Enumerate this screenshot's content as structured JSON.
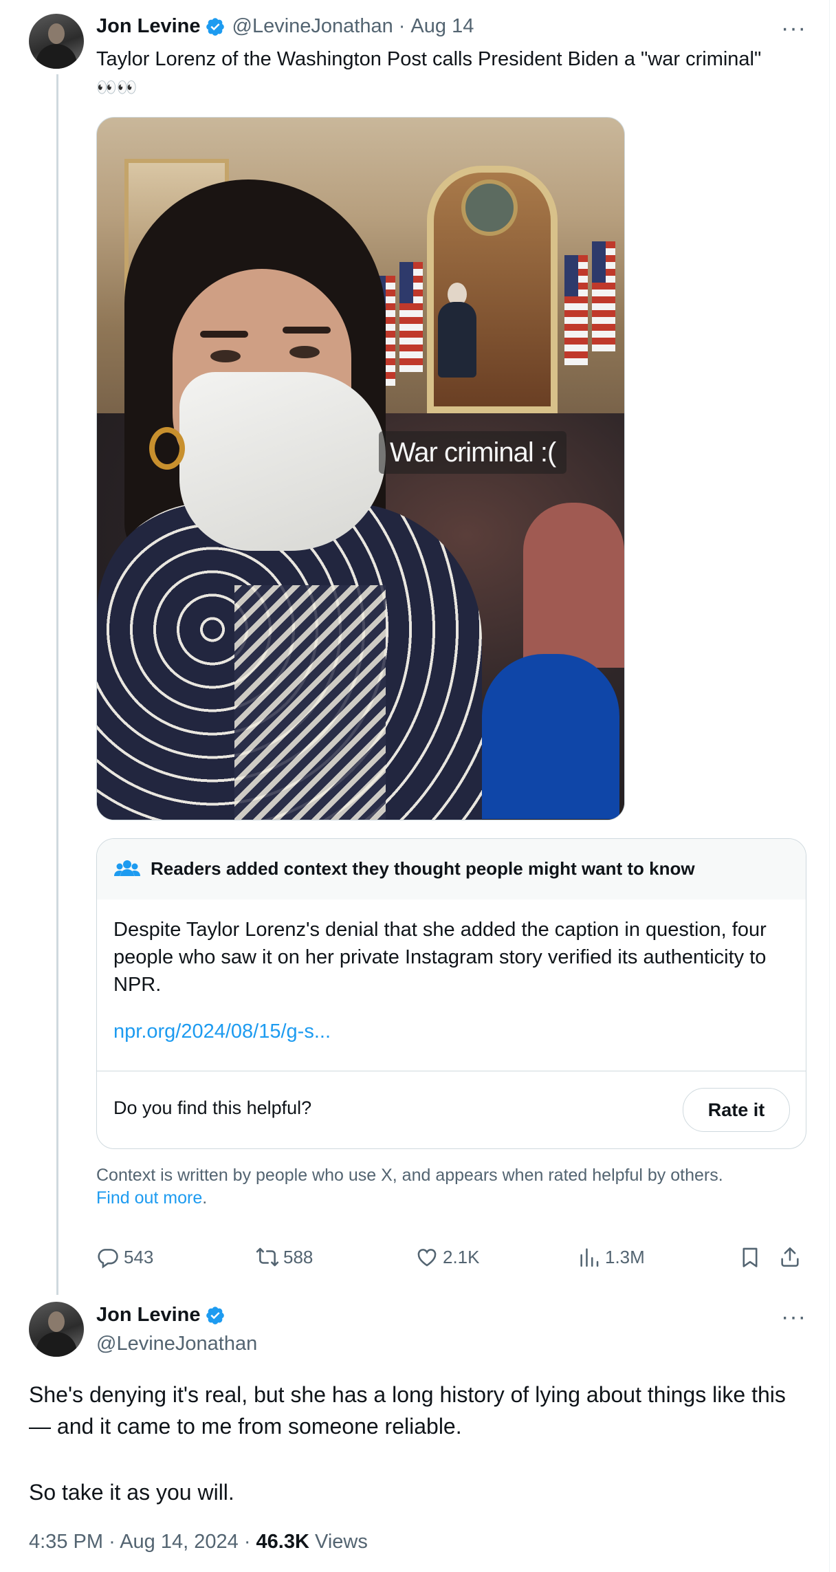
{
  "colors": {
    "accent": "#1d9bf0",
    "text": "#0f1419",
    "secondary": "#536471",
    "border": "#cfd9de",
    "verified": "#1d9bf0"
  },
  "tweet": {
    "author_name": "Jon Levine",
    "handle": "@LevineJonathan",
    "separator": "·",
    "date": "Aug 14",
    "text": "Taylor Lorenz of the Washington Post calls President Biden a \"war criminal\"",
    "emoji": "👀👀",
    "media": {
      "caption": "War criminal :("
    },
    "community_note": {
      "title": "Readers added context they thought people might want to know",
      "body": "Despite Taylor Lorenz's denial that she added the caption in question, four people who saw it on her private Instagram story verified its authenticity to NPR.",
      "link": "npr.org/2024/08/15/g-s...",
      "helpful_question": "Do you find this helpful?",
      "rate_button": "Rate it"
    },
    "context_disclaimer": "Context is written by people who use X, and appears when rated helpful by others.",
    "find_out_more": "Find out more",
    "period": ".",
    "stats": {
      "replies": "543",
      "reposts": "588",
      "likes": "2.1K",
      "views": "1.3M"
    }
  },
  "reply": {
    "author_name": "Jon Levine",
    "handle": "@LevineJonathan",
    "text_line1": "She's denying it's real, but she has a long history of lying about things like this — and it came to me from someone reliable.",
    "text_line2": "So take it as you will.",
    "time": "4:35 PM",
    "separator": "·",
    "date": "Aug 14, 2024",
    "views_count": "46.3K",
    "views_label": "Views"
  },
  "icons": {
    "verified": "verified-badge-icon",
    "more": "more-options-icon",
    "community": "community-people-icon",
    "reply": "reply-icon",
    "repost": "repost-icon",
    "like": "like-icon",
    "views": "views-chart-icon",
    "bookmark": "bookmark-icon",
    "share": "share-icon"
  }
}
